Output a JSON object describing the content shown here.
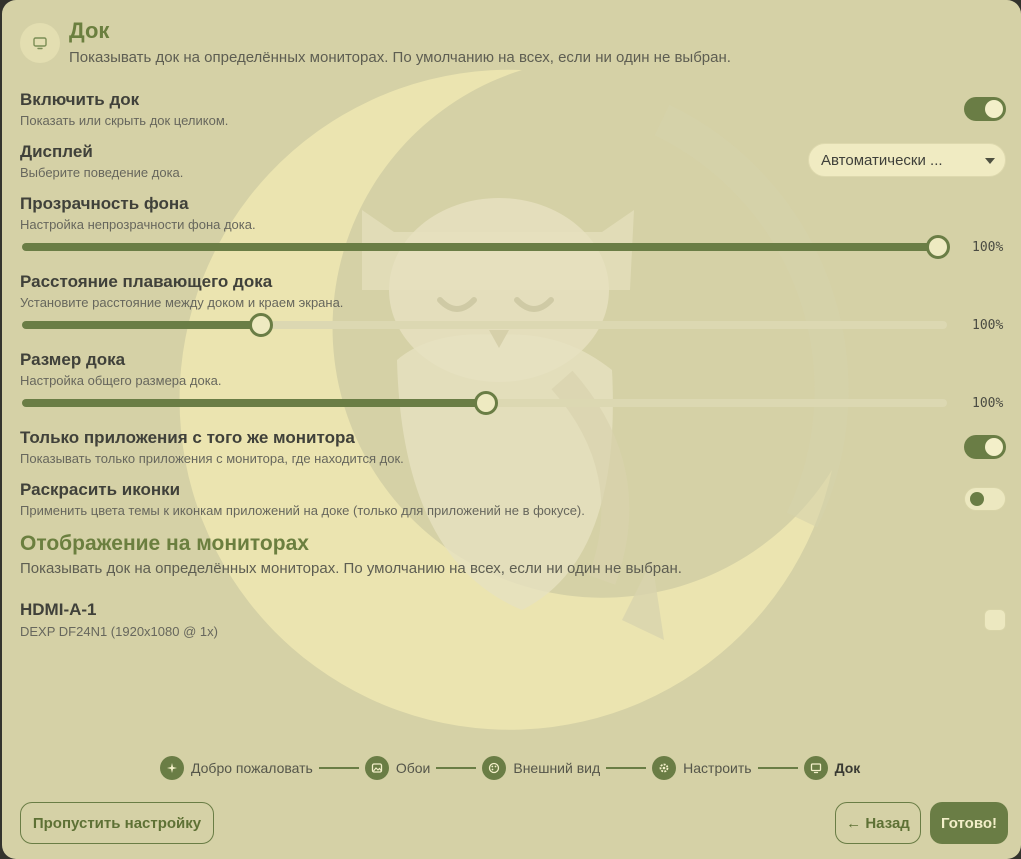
{
  "header": {
    "icon": "monitor-icon",
    "title": "Док",
    "subtitle": "Показывать док на определённых мониторах. По умолчанию на всех, если ни один не выбран."
  },
  "settings": {
    "enable_dock": {
      "title": "Включить док",
      "desc": "Показать или скрыть док целиком.",
      "enabled": true
    },
    "display": {
      "title": "Дисплей",
      "desc": "Выберите поведение дока.",
      "selected": "Автоматически ..."
    },
    "bg_opacity": {
      "title": "Прозрачность фона",
      "desc": "Настройка непрозрачности фона дока.",
      "value_label": "100%",
      "fraction": 0.99
    },
    "floating_distance": {
      "title": "Расстояние плавающего дока",
      "desc": "Установите расстояние между доком и краем экрана.",
      "value_label": "100%",
      "fraction": 0.258
    },
    "dock_size": {
      "title": "Размер дока",
      "desc": "Настройка общего размера дока.",
      "value_label": "100%",
      "fraction": 0.502
    },
    "same_monitor": {
      "title": "Только приложения с того же монитора",
      "desc": "Показывать только приложения с монитора, где находится док.",
      "enabled": true
    },
    "colorize_icons": {
      "title": "Раскрасить иконки",
      "desc": "Применить цвета темы к иконкам приложений на доке (только для приложений не в фокусе).",
      "enabled": false
    }
  },
  "monitors_section": {
    "title": "Отображение на мониторах",
    "desc": "Показывать док на определённых мониторах. По умолчанию на всех, если ни один не выбран.",
    "items": [
      {
        "name": "HDMI-A-1",
        "desc": "DEXP DF24N1 (1920x1080 @ 1x)",
        "checked": false
      }
    ]
  },
  "stepper": {
    "steps": [
      {
        "label": "Добро пожаловать",
        "icon": "sparkles-icon"
      },
      {
        "label": "Обои",
        "icon": "image-icon"
      },
      {
        "label": "Внешний вид",
        "icon": "palette-icon"
      },
      {
        "label": "Настроить",
        "icon": "gear-icon"
      },
      {
        "label": "Док",
        "icon": "monitor-icon"
      }
    ],
    "active_index": 4
  },
  "footer": {
    "skip_label": "Пропустить настройку",
    "back_label": "← Назад",
    "done_label": "Готово!"
  },
  "colors": {
    "background": "#d5d1a6",
    "accent": "#6a7d45",
    "title": "#6b7f3f"
  }
}
